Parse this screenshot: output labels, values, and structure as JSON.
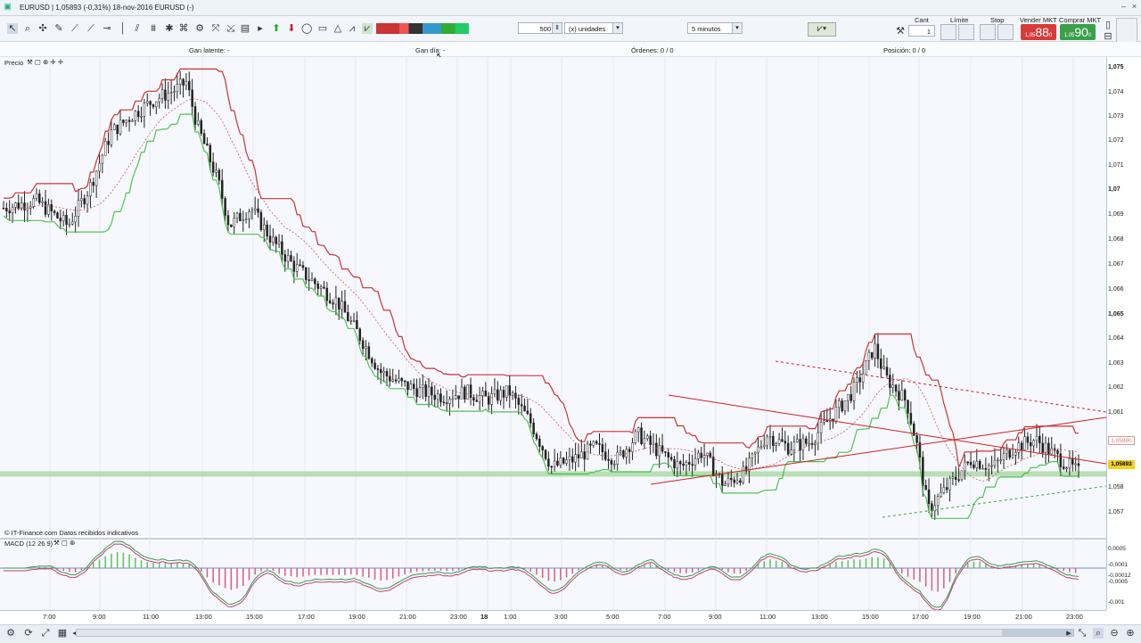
{
  "window": {
    "title": "EURUSD | 1,05893 (-0,31%) 18-nov-2016 EURUSD (-)"
  },
  "toolbar": {
    "quantity_value": "500",
    "units_value": "(x) unidades",
    "interval_value": "5 minutos"
  },
  "trade_panel": {
    "cant_label": "Cant",
    "cant_value": "1",
    "limit_label": "Límite",
    "stop_label": "Stop",
    "sell_label": "Vender MKT",
    "buy_label": "Comprar MKT",
    "sell_price_small": "1,05",
    "sell_price_big": "88",
    "sell_price_sup": "0",
    "buy_price_small": "1,05",
    "buy_price_big": "90",
    "buy_price_sup": "0"
  },
  "info_bar": {
    "gan_latente": "Gan latente: -",
    "gan_dia": "Gan día: -",
    "ordenes": "Órdenes: 0 / 0",
    "posicion": "Posición: 0 / 0"
  },
  "price_panel": {
    "label": "Precio",
    "footer": "© IT-Finance.com Datos recibidos indicativos",
    "price_ticks": [
      "1,075",
      "1,074",
      "1,073",
      "1,072",
      "1,071",
      "1,07",
      "1,069",
      "1,068",
      "1,067",
      "1,066",
      "1,065",
      "1,064",
      "1,063",
      "1,062",
      "1,061",
      "1,059",
      "1,058",
      "1,057"
    ],
    "ghost_badge": "1,05990",
    "current_badge": "1,05893"
  },
  "macd_panel": {
    "label": "MACD (12 26 9)",
    "ticks": [
      "0,0005",
      "-0,0001",
      "-0,00012",
      "-0,0005",
      "-0,001"
    ]
  },
  "time_axis": {
    "ticks": [
      "7:00",
      "9:00",
      "11:00",
      "13:00",
      "15:00",
      "17:00",
      "19:00",
      "21:00",
      "23:00",
      "18",
      "1:00",
      "3:00",
      "5:00",
      "7:00",
      "9:00",
      "11:00",
      "13:00",
      "15:00",
      "17:00",
      "19:00",
      "21:00",
      "23:00"
    ]
  },
  "colors": {
    "resistance_line": "#cc3333",
    "support_line": "#33bb33",
    "current_price_band": "#a8d8a0",
    "sell_button": "#d93a3a",
    "buy_button": "#3aa14a"
  },
  "chart_data": {
    "type": "candlestick",
    "symbol": "EURUSD",
    "interval": "5 minutos",
    "ylim": [
      1.0565,
      1.0755
    ],
    "x_ticks": [
      "7:00",
      "9:00",
      "11:00",
      "13:00",
      "15:00",
      "17:00",
      "19:00",
      "21:00",
      "23:00",
      "18",
      "1:00",
      "3:00",
      "5:00",
      "7:00",
      "9:00",
      "11:00",
      "13:00",
      "15:00",
      "17:00",
      "19:00",
      "21:00",
      "23:00"
    ],
    "price_path": [
      [
        0,
        1.0695
      ],
      [
        3,
        1.0698
      ],
      [
        6,
        1.0688
      ],
      [
        8,
        1.0703
      ],
      [
        10,
        1.0725
      ],
      [
        12,
        1.0732
      ],
      [
        14,
        1.0738
      ],
      [
        16,
        1.0742
      ],
      [
        17,
        1.0745
      ],
      [
        18,
        1.0728
      ],
      [
        20,
        1.0705
      ],
      [
        21,
        1.0688
      ],
      [
        23,
        1.0695
      ],
      [
        25,
        1.0682
      ],
      [
        27,
        1.0672
      ],
      [
        29,
        1.0665
      ],
      [
        31,
        1.0658
      ],
      [
        33,
        1.0645
      ],
      [
        35,
        1.063
      ],
      [
        37,
        1.0625
      ],
      [
        39,
        1.0622
      ],
      [
        41,
        1.062
      ],
      [
        43,
        1.0622
      ],
      [
        45,
        1.0619
      ],
      [
        47,
        1.0622
      ],
      [
        49,
        1.061
      ],
      [
        51,
        1.0592
      ],
      [
        53,
        1.0595
      ],
      [
        55,
        1.06
      ],
      [
        57,
        1.0595
      ],
      [
        59,
        1.0605
      ],
      [
        61,
        1.0598
      ],
      [
        63,
        1.0592
      ],
      [
        65,
        1.0598
      ],
      [
        67,
        1.0585
      ],
      [
        69,
        1.059
      ],
      [
        71,
        1.0605
      ],
      [
        73,
        1.06
      ],
      [
        75,
        1.0602
      ],
      [
        77,
        1.0612
      ],
      [
        79,
        1.0622
      ],
      [
        80,
        1.063
      ],
      [
        81,
        1.064
      ],
      [
        82,
        1.0628
      ],
      [
        84,
        1.0618
      ],
      [
        85,
        1.06
      ],
      [
        86,
        1.0575
      ],
      [
        87,
        1.058
      ],
      [
        88,
        1.0585
      ],
      [
        90,
        1.0595
      ],
      [
        92,
        1.0592
      ],
      [
        94,
        1.06
      ],
      [
        96,
        1.0603
      ],
      [
        98,
        1.0596
      ],
      [
        100,
        1.059
      ]
    ],
    "current_price": 1.05893,
    "macd_label": "MACD (12 26 9)"
  }
}
